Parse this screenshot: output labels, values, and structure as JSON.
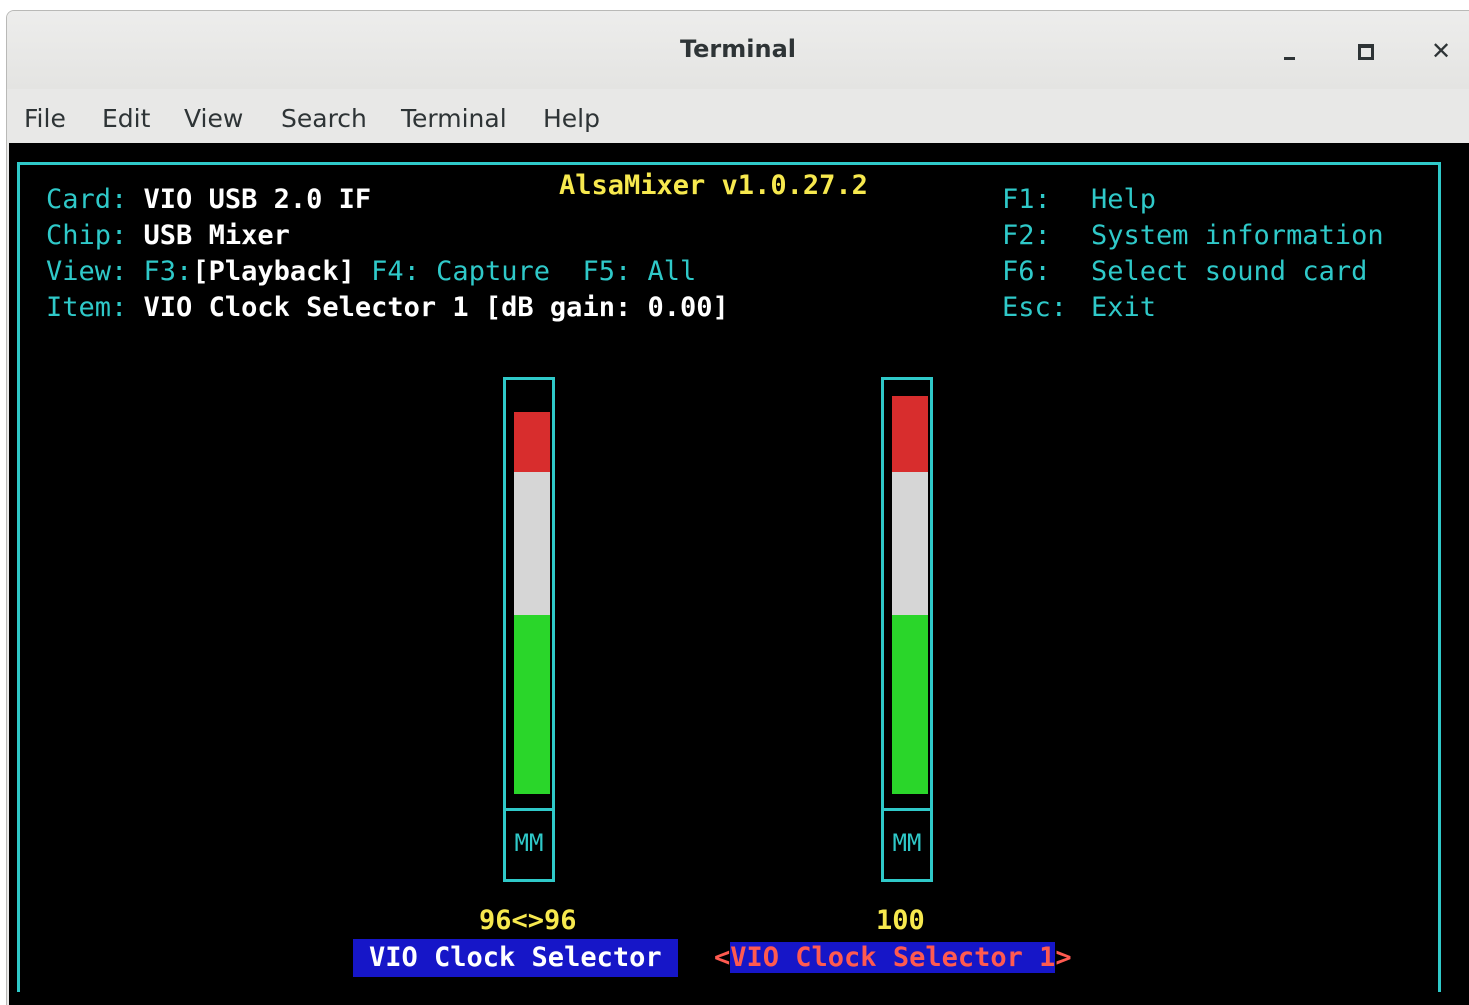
{
  "window": {
    "title": "Terminal",
    "controls": {
      "minimize": "minimize-icon",
      "maximize": "maximize-icon",
      "close": "close-icon"
    }
  },
  "menu": [
    "File",
    "Edit",
    "View",
    "Search",
    "Terminal",
    "Help"
  ],
  "alsamixer": {
    "title": "AlsaMixer v1.0.27.2",
    "card_label": "Card:",
    "card_value": "VIO USB 2.0 IF",
    "chip_label": "Chip:",
    "chip_value": "USB Mixer",
    "view_label": "View:",
    "view_f3": "F3:",
    "view_playback": "[Playback]",
    "view_f4": "F4: Capture",
    "view_f5": "F5: All",
    "item_label": "Item:",
    "item_value": "VIO Clock Selector 1 [dB gain: 0.00]",
    "keys": [
      {
        "key": "F1:",
        "action": "Help"
      },
      {
        "key": "F2:",
        "action": "System information"
      },
      {
        "key": "F6:",
        "action": "Select sound card"
      },
      {
        "key": "Esc:",
        "action": "Exit"
      }
    ],
    "controls": [
      {
        "name": "VIO Clock Selector",
        "value_text": "96<>96",
        "level": 0.96,
        "label": "MM"
      },
      {
        "name": "VIO Clock Selector 1",
        "value_text": "100",
        "level": 1.0,
        "label": "MM",
        "focused": true,
        "focus_open": "<",
        "focus_close": ">"
      }
    ]
  },
  "colors": {
    "frame": "#2fc9c9",
    "highlight": "#f7e94e",
    "meter_high": "#d82d2d",
    "meter_mid": "#d6d6d6",
    "meter_low": "#2ad62a",
    "selected_bg": "#1616c8"
  }
}
